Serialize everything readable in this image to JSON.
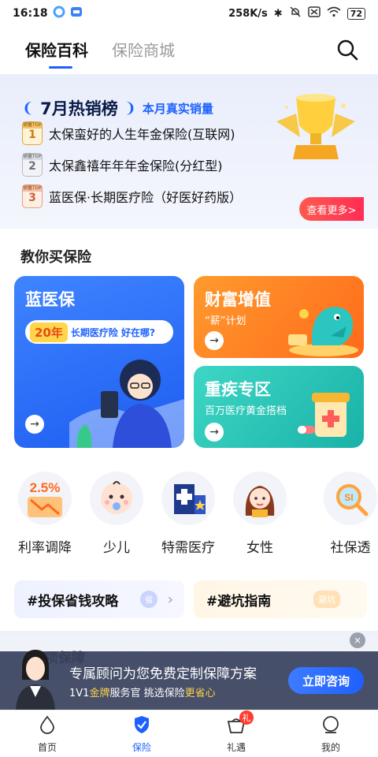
{
  "status_bar": {
    "time": "16:18",
    "network_speed": "258K/s",
    "battery": "72"
  },
  "tabs": [
    {
      "label": "保险百科",
      "active": true
    },
    {
      "label": "保险商城",
      "active": false
    }
  ],
  "hot_list": {
    "title": "7月热销榜",
    "subtitle": "本月真实销量",
    "badge_top_label": "销量TOP",
    "items": [
      {
        "rank": "1",
        "name": "太保蛮好的人生年金保险(互联网)"
      },
      {
        "rank": "2",
        "name": "太保鑫禧年年年金保险(分红型)"
      },
      {
        "rank": "3",
        "name": "蓝医保·长期医疗险（好医好药版）"
      }
    ],
    "see_more": "查看更多>"
  },
  "section": {
    "title": "教你买保险"
  },
  "cards": {
    "blue": {
      "title": "蓝医保",
      "pill_num": "20年",
      "pill_text": "长期医疗险  好在哪?"
    },
    "orange": {
      "title": "财富增值",
      "subtitle": "“薪”计划"
    },
    "teal": {
      "title": "重疾专区",
      "subtitle": "百万医疗黄金搭档"
    }
  },
  "categories": [
    {
      "label": "利率调降",
      "icon": "rate-down-icon",
      "badge": "2.5%"
    },
    {
      "label": "少儿",
      "icon": "baby-icon"
    },
    {
      "label": "特需医疗",
      "icon": "hospital-icon"
    },
    {
      "label": "女性",
      "icon": "woman-icon"
    },
    {
      "label": "社保透",
      "icon": "social-security-icon",
      "badge": "SI"
    }
  ],
  "guides": {
    "left": {
      "label": "#投保省钱攻略",
      "tag": "省"
    },
    "right": {
      "label": "#避坑指南",
      "tag": "避坑"
    }
  },
  "below_section": {
    "title": "专项保障"
  },
  "consult": {
    "main": "专属顾问为您免费定制保障方案",
    "sub_prefix": "1V1",
    "sub_gold": "金牌",
    "sub_middle": "服务官 挑选保险",
    "sub_save": "更省心",
    "button": "立即咨询",
    "close": "×"
  },
  "bottom_nav": [
    {
      "label": "首页",
      "icon": "home-icon",
      "active": false
    },
    {
      "label": "保险",
      "icon": "shield-icon",
      "active": true
    },
    {
      "label": "礼遇",
      "icon": "gift-icon",
      "active": false,
      "badge": "礼"
    },
    {
      "label": "我的",
      "icon": "profile-icon",
      "active": false
    }
  ],
  "colors": {
    "accent": "#1f5fff",
    "hot_red": "#ff2d55"
  }
}
